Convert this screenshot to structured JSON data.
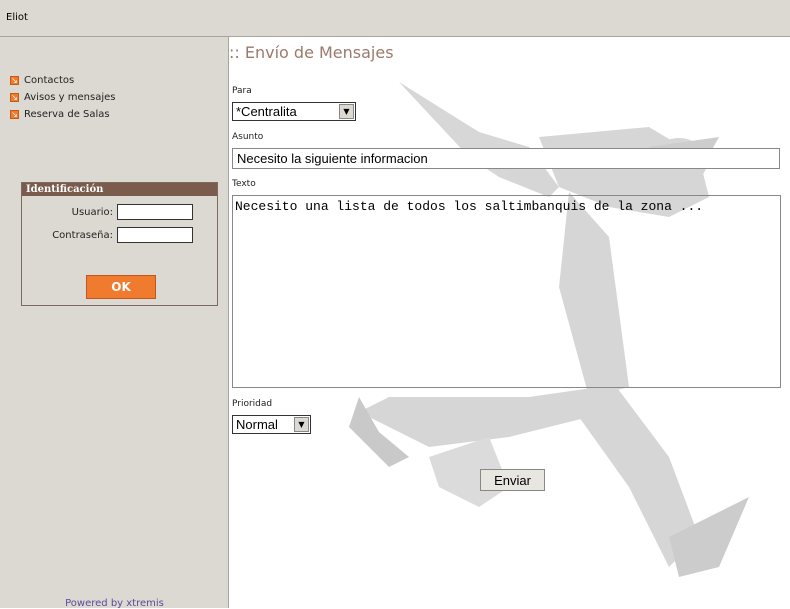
{
  "header": {
    "title": "Eliot"
  },
  "sidebar": {
    "nav": [
      {
        "label": "Contactos",
        "icon": "arrow-icon"
      },
      {
        "label": "Avisos y mensajes",
        "icon": "arrow-icon"
      },
      {
        "label": "Reserva de Salas",
        "icon": "arrow-icon"
      }
    ],
    "login": {
      "header": "Identificación",
      "user_label": "Usuario:",
      "user_value": "",
      "password_label": "Contraseña:",
      "password_value": "",
      "ok_label": "OK"
    },
    "powered": "Powered by xtremis"
  },
  "main": {
    "title": ":: Envío de Mensajes",
    "para_label": "Para",
    "para_value": "*Centralita",
    "asunto_label": "Asunto",
    "asunto_value": "Necesito la siguiente informacion",
    "texto_label": "Texto",
    "texto_value": "Necesito una lista de todos los saltimbanquis de la zona ...",
    "prioridad_label": "Prioridad",
    "prioridad_value": "Normal",
    "send_label": "Enviar"
  },
  "colors": {
    "accent": "#f07a2d",
    "sidebar_bg": "#dcd9d2",
    "login_header": "#7a5b4c",
    "title": "#9b7a6a"
  }
}
